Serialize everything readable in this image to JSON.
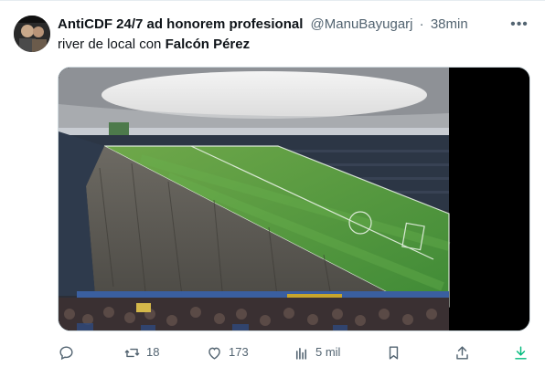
{
  "tweet": {
    "author": "AntiCDF 24/7 ad honorem profesional",
    "handle": "@ManuBayugarj",
    "separator": "·",
    "time": "38min",
    "text_prefix": "river de local con ",
    "text_bold": "Falcón Pérez"
  },
  "actions": {
    "reply_count": "",
    "retweet_count": "18",
    "like_count": "173",
    "views_count": "5 mil"
  },
  "icons": {
    "more": "more-dots-icon",
    "reply": "reply-icon",
    "retweet": "retweet-icon",
    "like": "heart-icon",
    "views": "views-bars-icon",
    "bookmark": "bookmark-icon",
    "share": "share-icon",
    "download": "download-icon"
  },
  "colors": {
    "text": "#0f1419",
    "muted": "#536471",
    "download_accent": "#00ba7c"
  }
}
